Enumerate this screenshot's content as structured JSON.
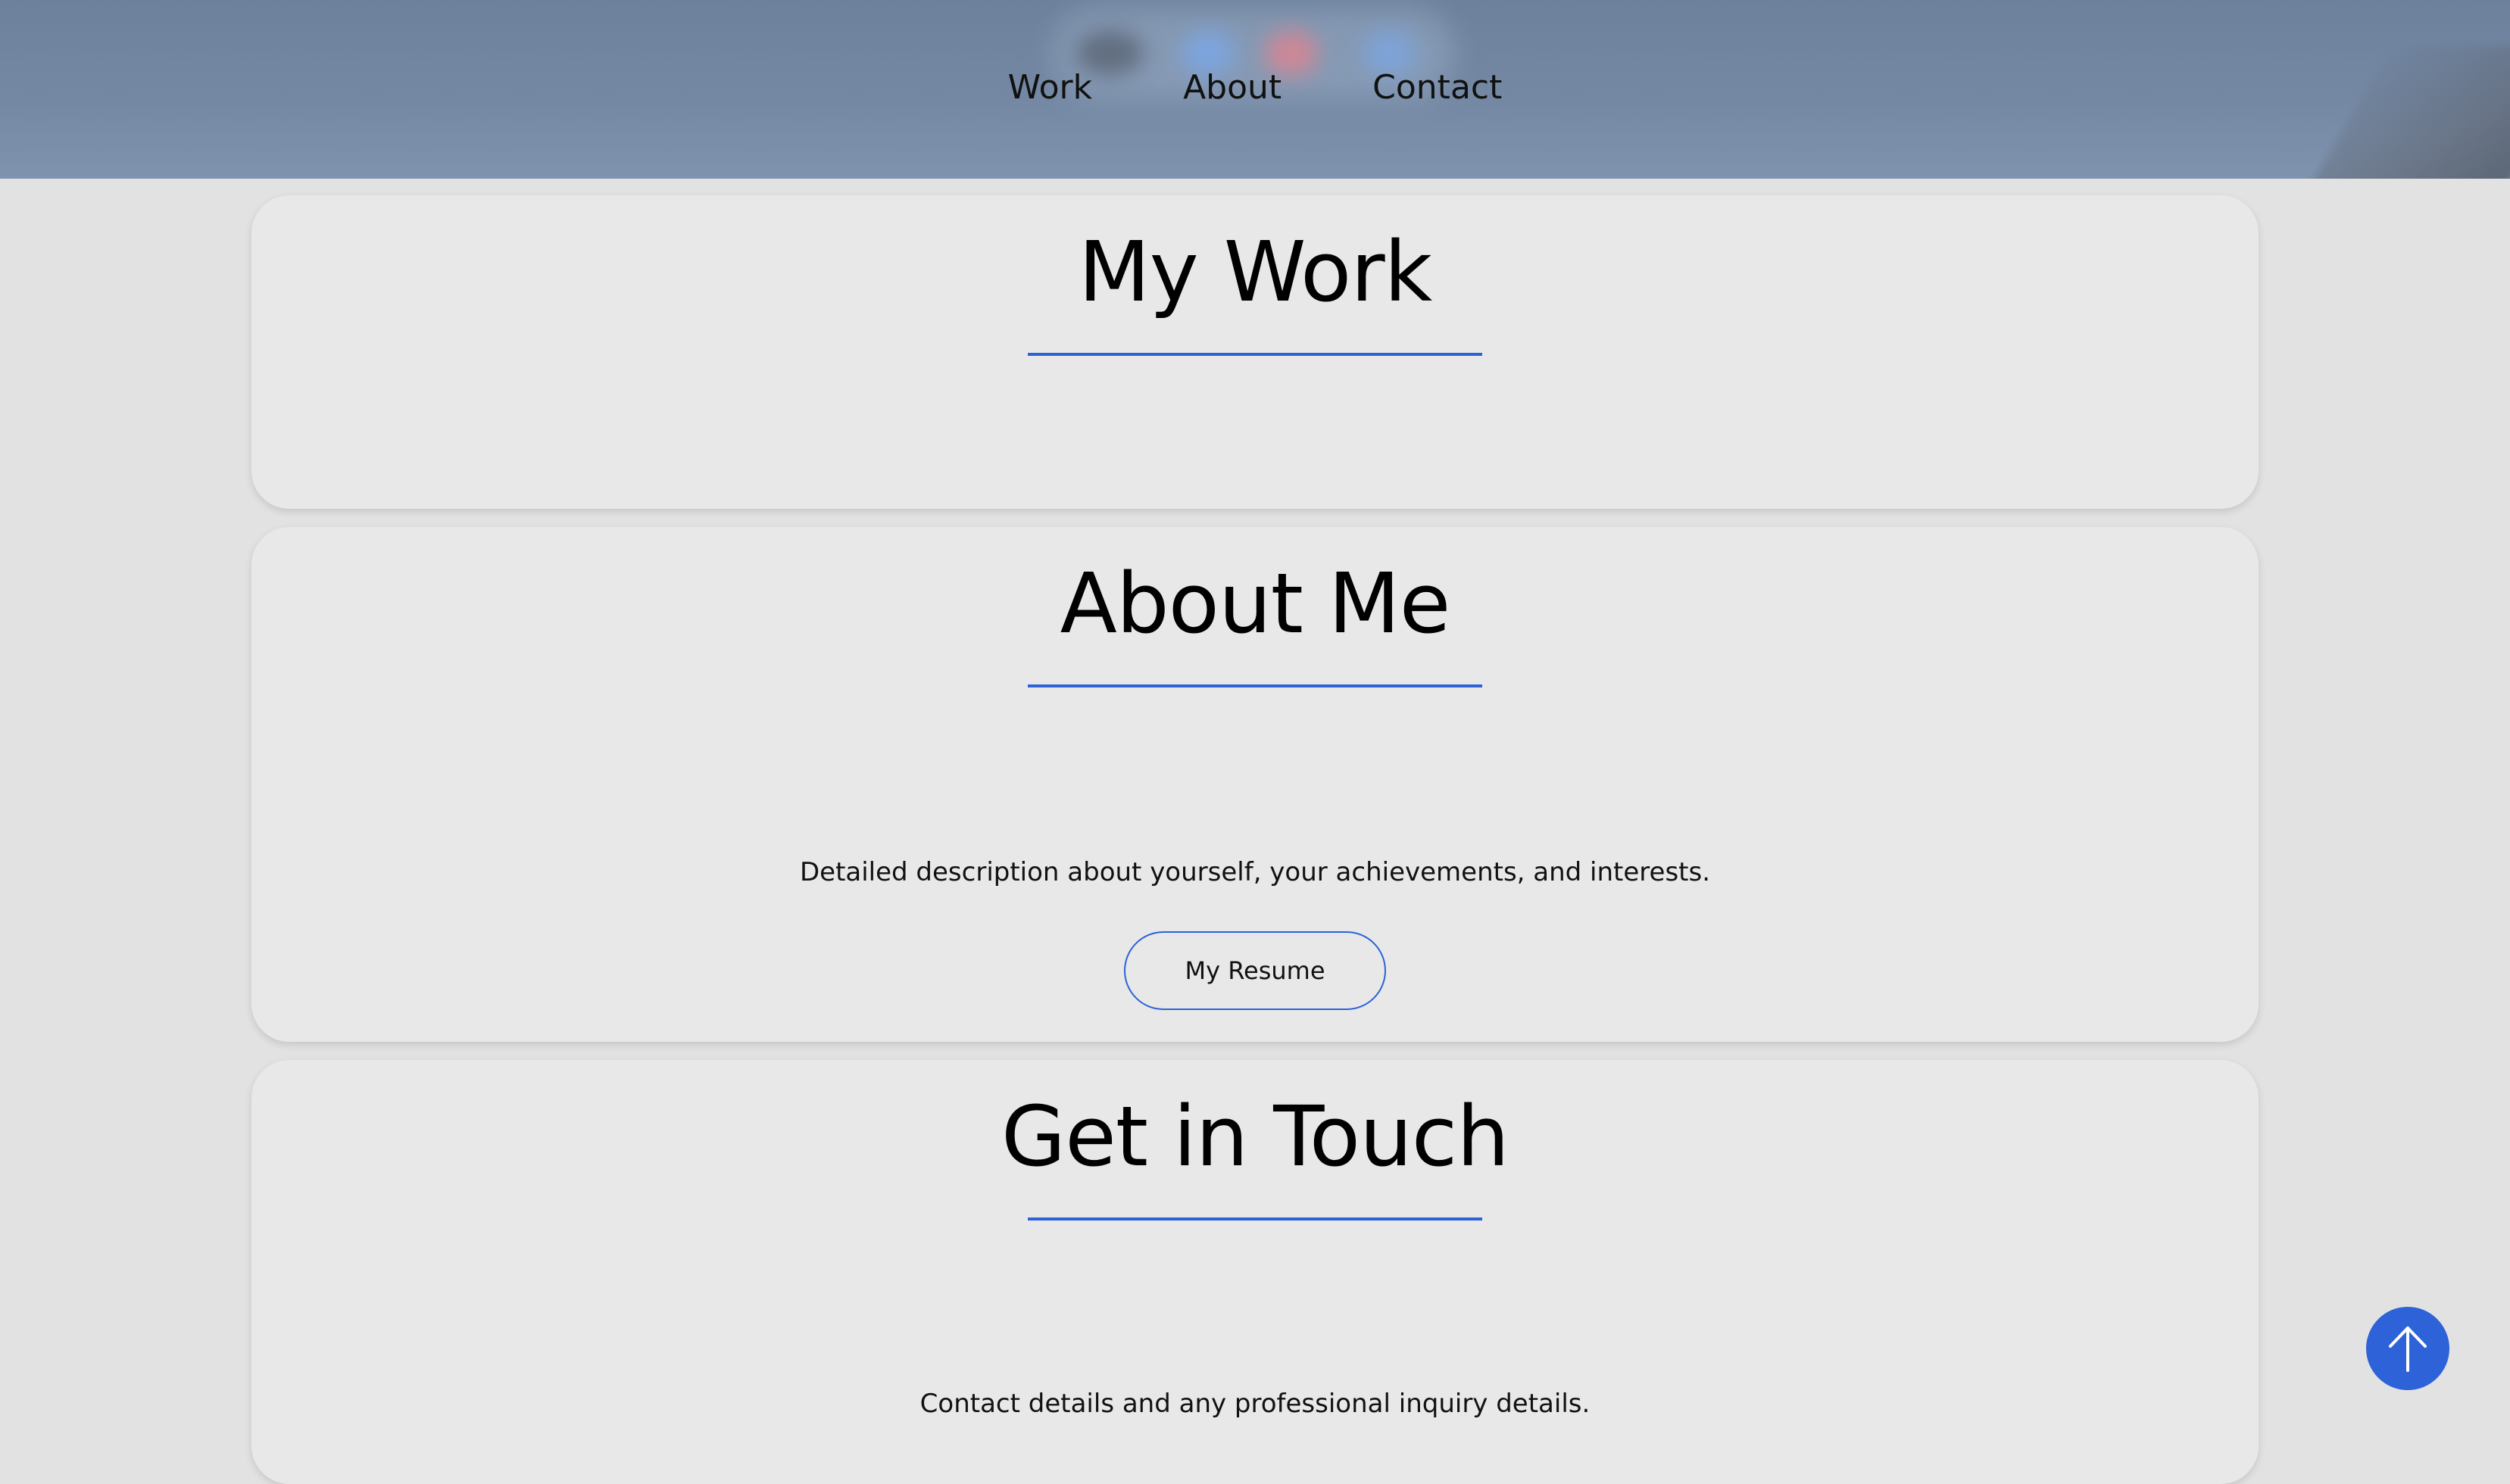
{
  "nav": {
    "items": [
      {
        "label": "Work"
      },
      {
        "label": "About"
      },
      {
        "label": "Contact"
      }
    ]
  },
  "work": {
    "title": "My Work"
  },
  "about": {
    "title": "About Me",
    "description": "Detailed description about yourself, your achievements, and interests.",
    "resume_label": "My Resume"
  },
  "contact": {
    "title": "Get in Touch",
    "description": "Contact details and any professional inquiry details."
  },
  "scroll_top": {
    "icon": "arrow-up-icon"
  },
  "colors": {
    "accent": "#2d62d8",
    "header": "#7488a4",
    "card": "#e8e8e8",
    "background": "#e2e2e2"
  }
}
